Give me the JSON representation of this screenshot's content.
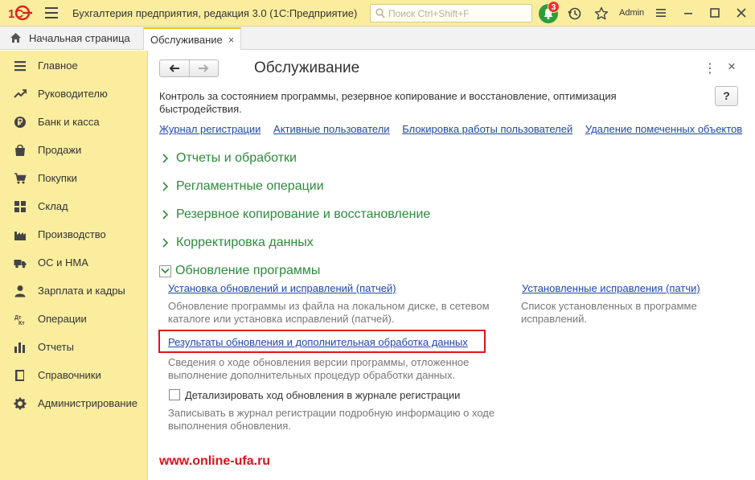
{
  "app": {
    "title": "Бухгалтерия предприятия, редакция 3.0  (1С:Предприятие)",
    "logo": "1C",
    "search_placeholder": "Поиск Ctrl+Shift+F",
    "notifications_count": "3",
    "user": "Admin",
    "accent_color": "#fbed9e"
  },
  "tabs": {
    "home_label": "Начальная страница",
    "active_label": "Обслуживание",
    "close_glyph": "×"
  },
  "sidebar": {
    "items": [
      {
        "label": "Главное",
        "icon": "menu-lines-icon"
      },
      {
        "label": "Руководителю",
        "icon": "trend-icon"
      },
      {
        "label": "Банк и касса",
        "icon": "ruble-icon"
      },
      {
        "label": "Продажи",
        "icon": "bag-icon"
      },
      {
        "label": "Покупки",
        "icon": "cart-icon"
      },
      {
        "label": "Склад",
        "icon": "warehouse-icon"
      },
      {
        "label": "Производство",
        "icon": "factory-icon"
      },
      {
        "label": "ОС и НМА",
        "icon": "truck-icon"
      },
      {
        "label": "Зарплата и кадры",
        "icon": "person-icon"
      },
      {
        "label": "Операции",
        "icon": "dt-kt-icon"
      },
      {
        "label": "Отчеты",
        "icon": "bar-chart-icon"
      },
      {
        "label": "Справочники",
        "icon": "book-icon"
      },
      {
        "label": "Администрирование",
        "icon": "gear-icon"
      }
    ]
  },
  "main": {
    "title": "Обслуживание",
    "help": "?",
    "description": "Контроль за состоянием программы, резервное копирование и восстановление, оптимизация быстродействия.",
    "links": [
      "Журнал регистрации",
      "Активные пользователи",
      "Блокировка работы пользователей",
      "Удаление помеченных объектов"
    ],
    "groups": [
      "Отчеты и обработки",
      "Регламентные операции",
      "Резервное копирование и восстановление",
      "Корректировка данных"
    ],
    "open_group": {
      "label": "Обновление программы",
      "install_link": "Установка обновлений и исправлений (патчей)",
      "install_desc": "Обновление программы из файла на локальном диске, в сетевом каталоге или установка исправлений (патчей).",
      "installed_link": "Установленные исправления (патчи)",
      "installed_desc": "Список установленных в программе исправлений.",
      "results_link": "Результаты обновления и дополнительная обработка данных",
      "results_desc": "Сведения о ходе обновления версии программы, отложенное выполнение дополнительных процедур обработки данных.",
      "checkbox_label": "Детализировать ход обновления в журнале регистрации",
      "checkbox_checked": false,
      "checkbox_desc": "Записывать в журнал регистрации подробную информацию о ходе выполнения обновления."
    },
    "watermark": "www.online-ufa.ru"
  }
}
